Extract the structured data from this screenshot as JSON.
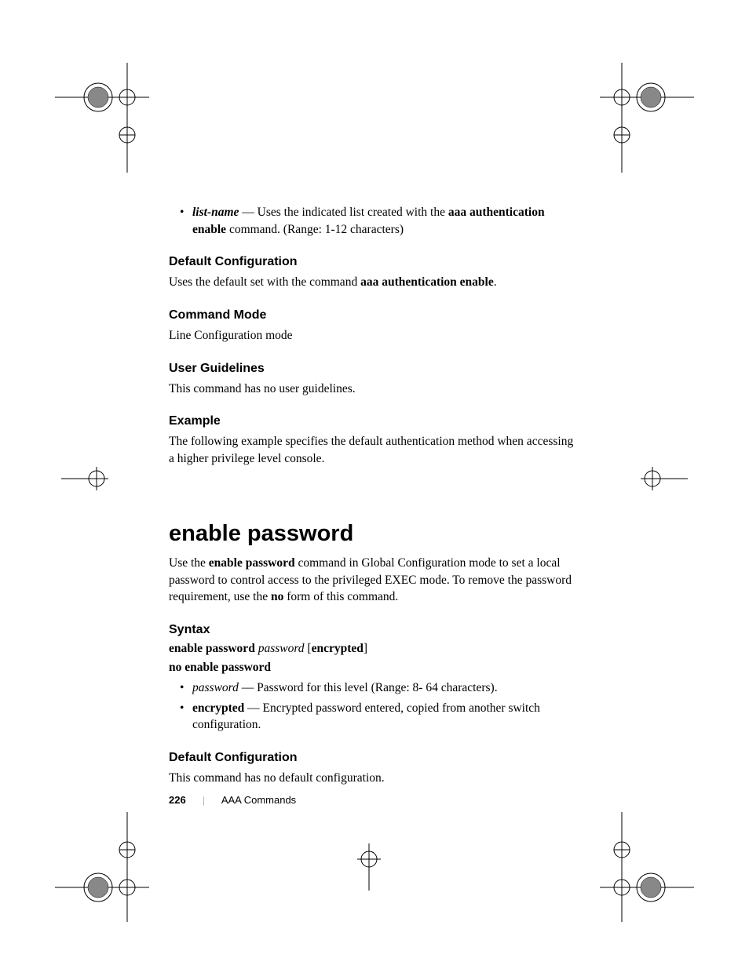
{
  "bullet1": {
    "param": "list-name",
    "dash": " — ",
    "text1": "Uses the indicated list created with the ",
    "bold1": "aaa authentication enable",
    "text2": " command. (Range: 1-12 characters)"
  },
  "sec1": {
    "heading": "Default Configuration",
    "text1": "Uses the default set with the command ",
    "bold1": "aaa authentication enable",
    "text2": "."
  },
  "sec2": {
    "heading": "Command Mode",
    "text": "Line Configuration mode"
  },
  "sec3": {
    "heading": "User Guidelines",
    "text": "This command has no user guidelines."
  },
  "sec4": {
    "heading": "Example",
    "text": "The following example specifies the default authentication method when accessing a higher privilege level console."
  },
  "main": {
    "heading": "enable password",
    "text1": "Use the ",
    "bold1": "enable password",
    "text2": " command in Global Configuration mode to set a local password to control access to the privileged EXEC mode. To remove the password requirement, use the ",
    "bold2": "no",
    "text3": " form of this command."
  },
  "syntax": {
    "heading": "Syntax",
    "line1_bold": "enable password ",
    "line1_italic": "password",
    "line1_text": " [",
    "line1_bold2": "encrypted",
    "line1_text2": "]",
    "line2": "no enable password"
  },
  "sbullet1": {
    "param": "password",
    "dash": " — ",
    "text": "Password for this level (Range: 8- 64 characters)."
  },
  "sbullet2": {
    "param": "encrypted",
    "dash": " — ",
    "text": "Encrypted password entered, copied from another switch configuration."
  },
  "sec5": {
    "heading": "Default Configuration",
    "text": "This command has no default configuration."
  },
  "footer": {
    "page": "226",
    "sep": "|",
    "section": "AAA Commands"
  }
}
